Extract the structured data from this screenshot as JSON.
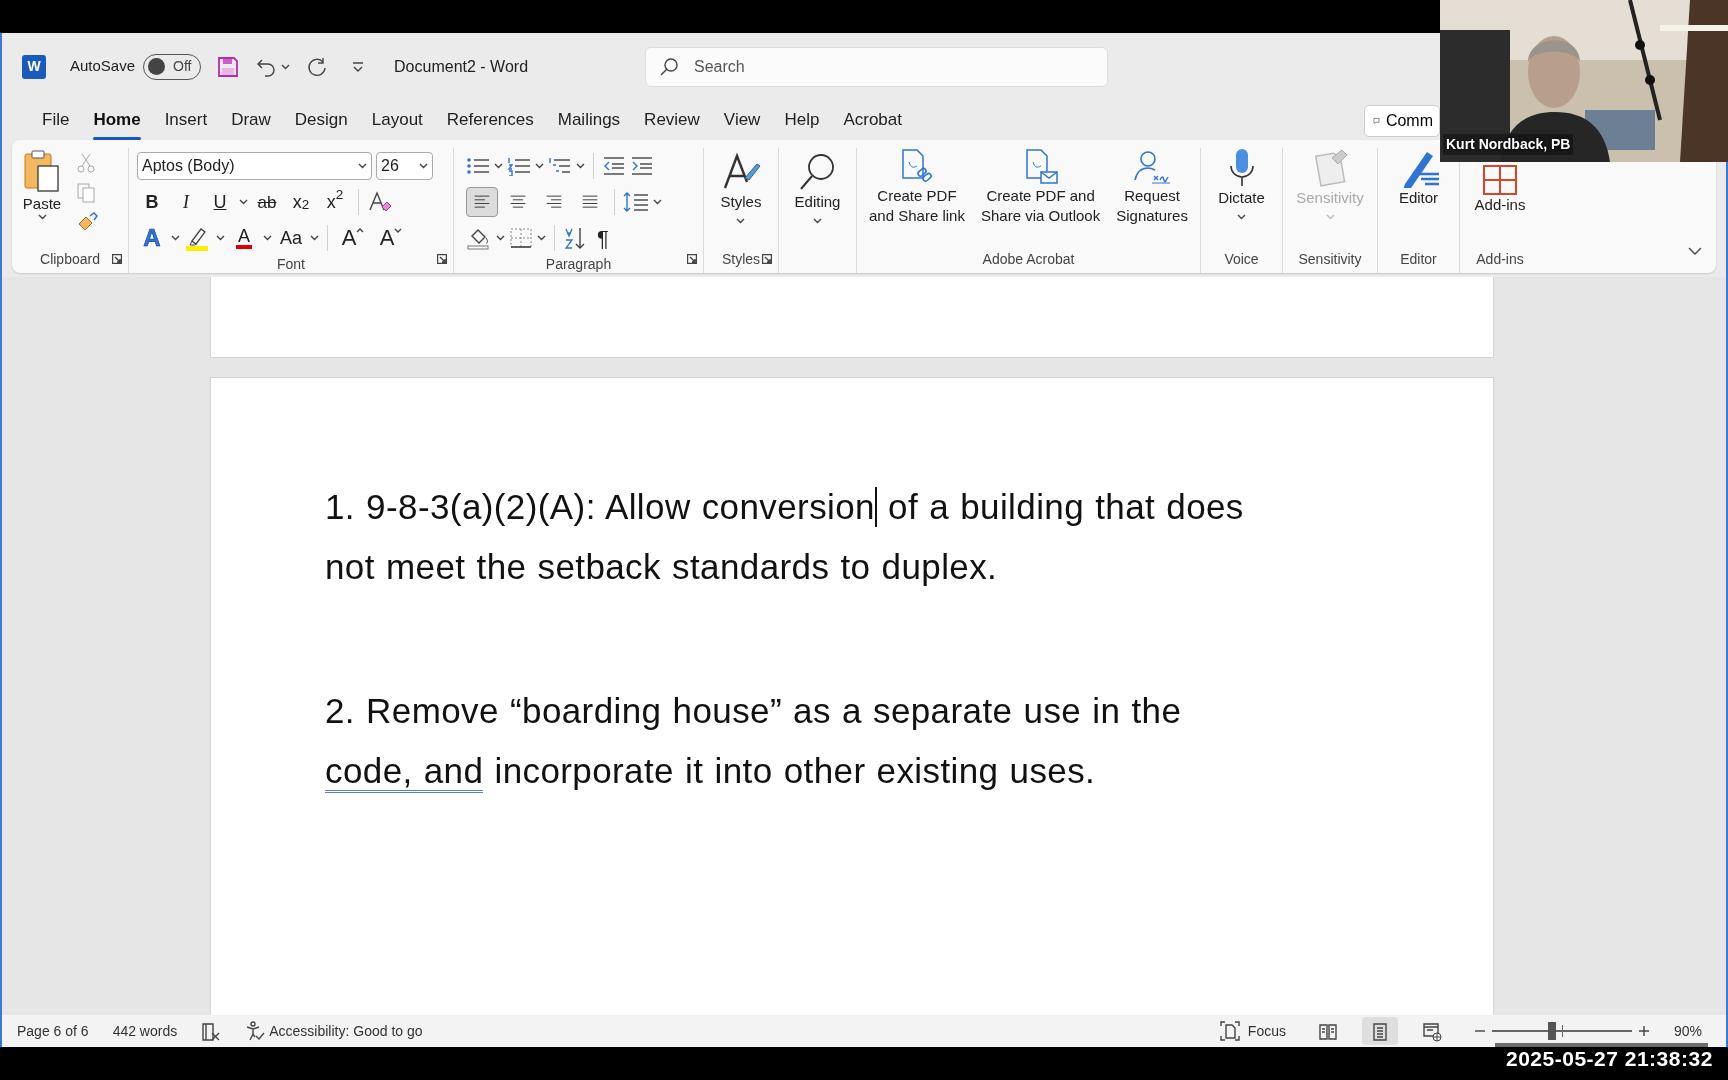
{
  "title_bar": {
    "logo_letter": "W",
    "autosave_label": "AutoSave",
    "autosave": {
      "label": "Off",
      "on": false
    },
    "document_title": "Document2  -  Word",
    "search": {
      "placeholder": "Search"
    }
  },
  "menu_tabs": [
    {
      "label": "File",
      "selected": false
    },
    {
      "label": "Home",
      "selected": true
    },
    {
      "label": "Insert",
      "selected": false
    },
    {
      "label": "Draw",
      "selected": false
    },
    {
      "label": "Design",
      "selected": false
    },
    {
      "label": "Layout",
      "selected": false
    },
    {
      "label": "References",
      "selected": false
    },
    {
      "label": "Mailings",
      "selected": false
    },
    {
      "label": "Review",
      "selected": false
    },
    {
      "label": "View",
      "selected": false
    },
    {
      "label": "Help",
      "selected": false
    },
    {
      "label": "Acrobat",
      "selected": false
    }
  ],
  "comments_button": {
    "label": "Comm"
  },
  "ribbon": {
    "clipboard": {
      "paste_label": "Paste",
      "group_label": "Clipboard"
    },
    "font": {
      "font_name": "Aptos (Body)",
      "font_size": "26",
      "row_1": [
        {
          "kind": "bold",
          "label": "B"
        },
        {
          "kind": "italic",
          "label": "I"
        },
        {
          "kind": "underline",
          "label": "U"
        },
        {
          "kind": "strikethrough",
          "label": "ab"
        },
        {
          "kind": "subscript",
          "label": "x$_{2}$"
        },
        {
          "kind": "superscript",
          "label": "x$^{2}$"
        }
      ],
      "row_2": [
        {
          "kind": "effects",
          "label": "A"
        },
        {
          "kind": "highlight"
        },
        {
          "kind": "color",
          "label": "A"
        },
        {
          "kind": "case",
          "label": "Aa"
        },
        {
          "kind": "grow",
          "label": "A"
        },
        {
          "kind": "shrink",
          "label": "A"
        }
      ],
      "group_label": "Font"
    },
    "paragraph": {
      "alignment": [
        {
          "selected": true
        },
        {
          "selected": false
        },
        {
          "selected": false
        },
        {
          "selected": false
        }
      ],
      "show_marks": "¶",
      "group_label": "Paragraph"
    },
    "styles": {
      "label": "Styles",
      "group_label": "Styles"
    },
    "editing": {
      "label": "Editing"
    },
    "adobe_acrobat": {
      "buttons": [
        {
          "kind": "share_link",
          "label": "Create PDF\nand Share link"
        },
        {
          "kind": "outlook",
          "label": "Create PDF and\nShare via Outlook"
        },
        {
          "kind": "signatures",
          "label": "Request\nSignatures"
        }
      ],
      "group_label": "Adobe Acrobat"
    },
    "voice": {
      "label": "Dictate",
      "group_label": "Voice"
    },
    "sensitivity": {
      "label": "Sensitivity",
      "disabled": true,
      "group_label": "Sensitivity"
    },
    "editor": {
      "label": "Editor",
      "group_label": "Editor"
    },
    "add_ins": {
      "label": "Add-ins",
      "group_label": "Add-ins"
    }
  },
  "document": {
    "paragraphs": [
      {
        "lines": [
          [
            {
              "kind": "text",
              "text": "1. 9-8-3(a)(2)(A): Allow conversion"
            },
            {
              "kind": "cursor"
            },
            {
              "kind": "text",
              "text": " of a building that does"
            }
          ],
          [
            {
              "kind": "text",
              "text": "not meet the setback standards to duplex."
            }
          ]
        ]
      },
      {
        "lines": [
          [
            {
              "kind": "text",
              "text": "2. Remove “boarding house” as a separate use in the"
            }
          ],
          [
            {
              "kind": "flagged",
              "text": "code, and"
            },
            {
              "kind": "text",
              "text": " incorporate it into other existing uses."
            }
          ]
        ]
      }
    ]
  },
  "status_bar": {
    "page": "Page 6 of 6",
    "words": "442 words",
    "accessibility": "Accessibility: Good to go",
    "focus": "Focus",
    "views": [
      {
        "kind": "read",
        "selected": false
      },
      {
        "kind": "print",
        "selected": true
      },
      {
        "kind": "web",
        "selected": false
      }
    ],
    "zoom": {
      "level": 0.43,
      "label": "90%"
    }
  },
  "video_tile": {
    "participant_name": "Kurt Nordback, PB"
  },
  "recording_timestamp": "2025-05-27 21:38:32"
}
